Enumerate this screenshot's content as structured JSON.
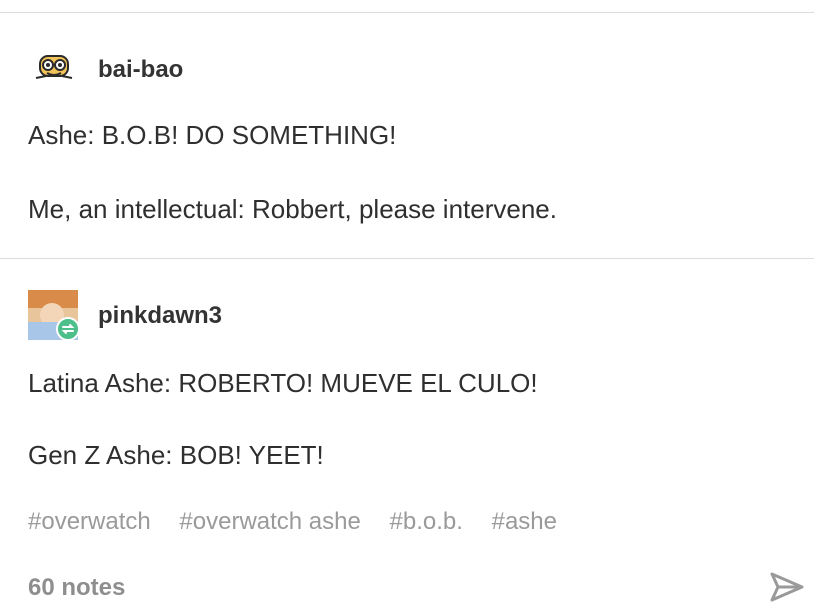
{
  "posts": [
    {
      "username": "bai-bao",
      "lines": [
        "Ashe: B.O.B! DO SOMETHING!",
        "Me, an intellectual: Robbert, please intervene."
      ]
    },
    {
      "username": "pinkdawn3",
      "lines": [
        "Latina Ashe: ROBERTO! MUEVE EL CULO!",
        "Gen Z Ashe: BOB! YEET!"
      ]
    }
  ],
  "tags": [
    "#overwatch",
    "#overwatch ashe",
    "#b.o.b.",
    "#ashe"
  ],
  "notes": "60 notes",
  "icons": {
    "avatar_1": "cartoon-bread-avatar-icon",
    "avatar_2": "photo-avatar",
    "reblog": "reblog-icon",
    "share": "send-arrow-icon"
  },
  "colors": {
    "reblog_badge": "#4cbf8a",
    "tags": "#9a9a9a",
    "notes": "#8e8e8e"
  }
}
